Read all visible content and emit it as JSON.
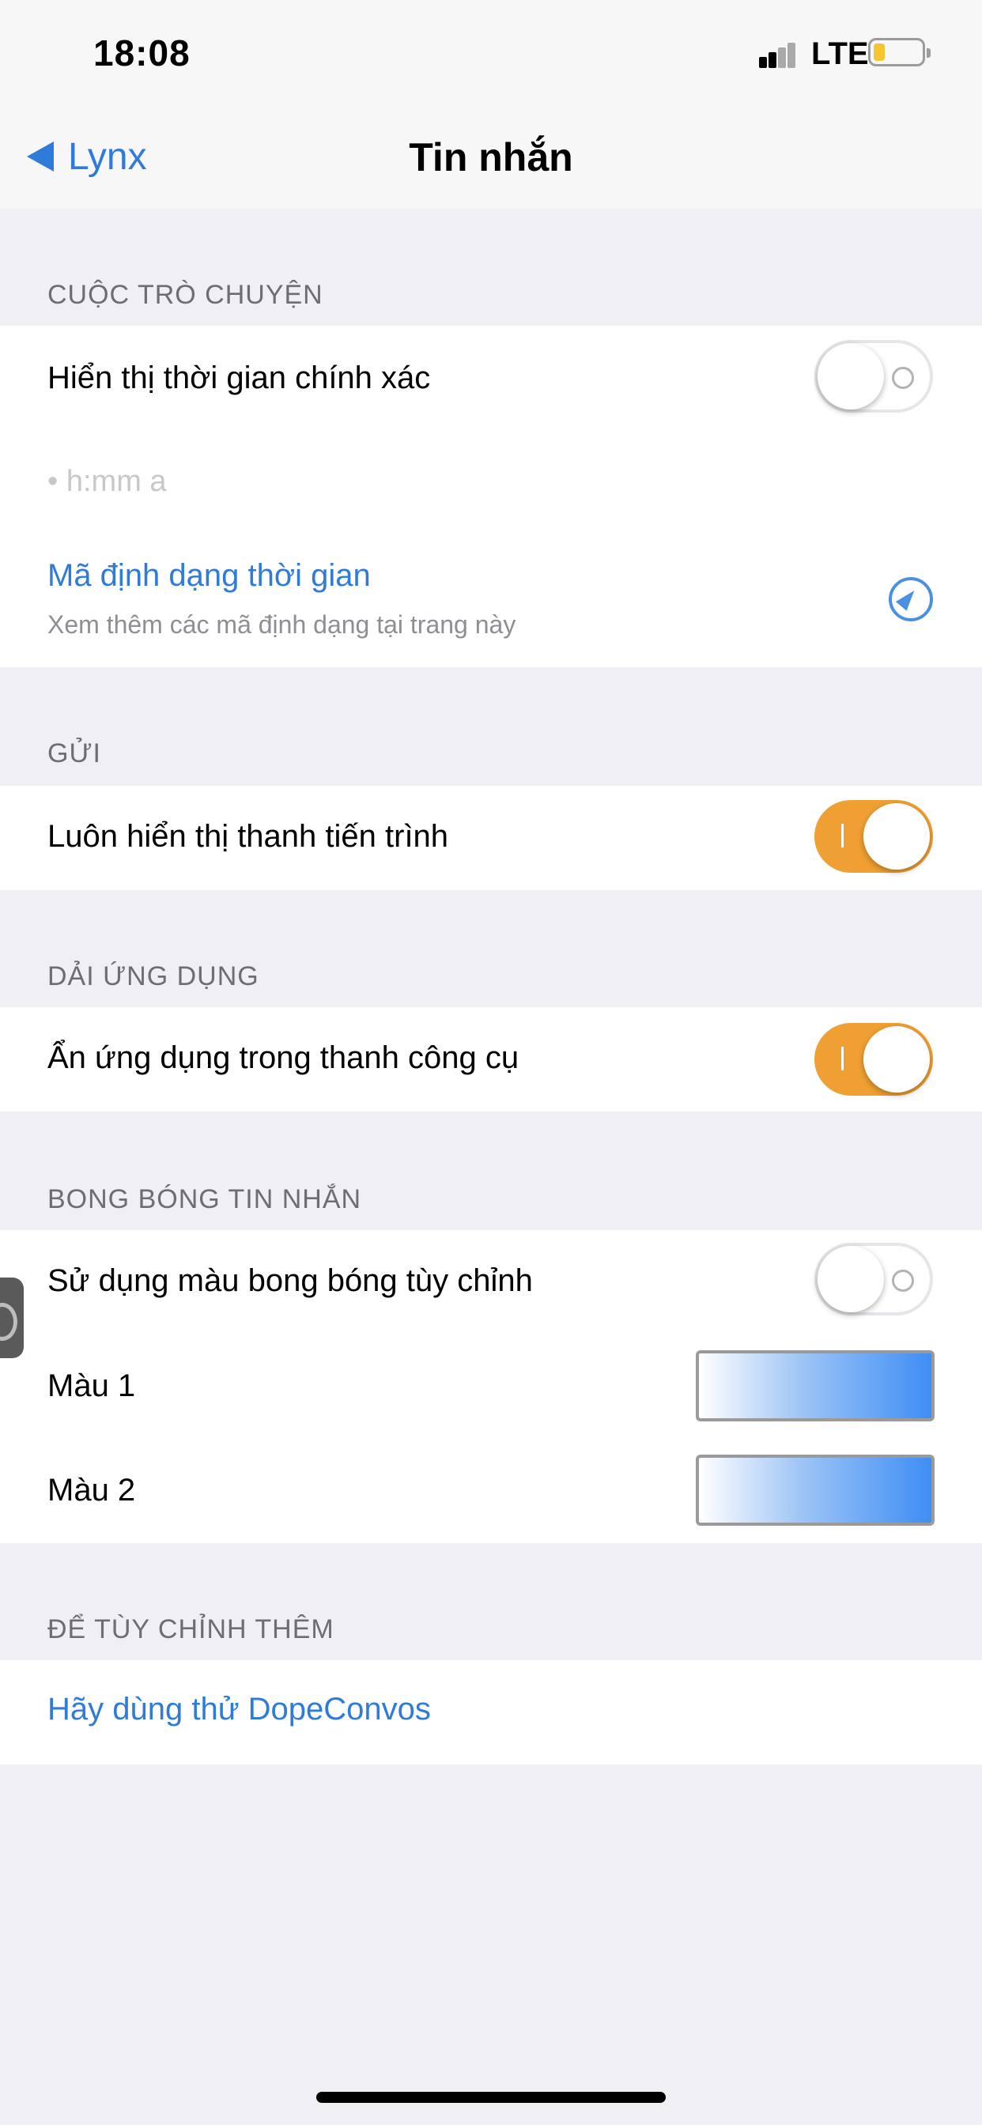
{
  "status_bar": {
    "time": "18:08",
    "network": "LTE"
  },
  "nav": {
    "back_label": "Lynx",
    "title": "Tin nhắn"
  },
  "sections": {
    "conversation": {
      "header": "CUỘC TRÒ CHUYỆN",
      "exact_time_label": "Hiển thị thời gian chính xác",
      "exact_time_on": false,
      "format_placeholder": "• h:mm a",
      "format_link_title": "Mã định dạng thời gian",
      "format_link_subtitle": "Xem thêm các mã định dạng tại trang này"
    },
    "send": {
      "header": "GỬI",
      "progress_label": "Luôn hiển thị thanh tiến trình",
      "progress_on": true
    },
    "app_strip": {
      "header": "DẢI ỨNG DỤNG",
      "hide_apps_label": "Ẩn ứng dụng trong thanh công cụ",
      "hide_apps_on": true
    },
    "bubbles": {
      "header": "BONG BÓNG TIN NHẮN",
      "custom_color_label": "Sử dụng màu bong bóng tùy chỉnh",
      "custom_color_on": false,
      "color1_label": "Màu 1",
      "color2_label": "Màu 2"
    },
    "more": {
      "header": "ĐỂ TÙY CHỈNH THÊM",
      "cta_label": "Hãy dùng thử DopeConvos"
    }
  },
  "colors": {
    "accent": "#2f7bd9",
    "toggle_on": "#f0a032",
    "background": "#efeff4"
  }
}
